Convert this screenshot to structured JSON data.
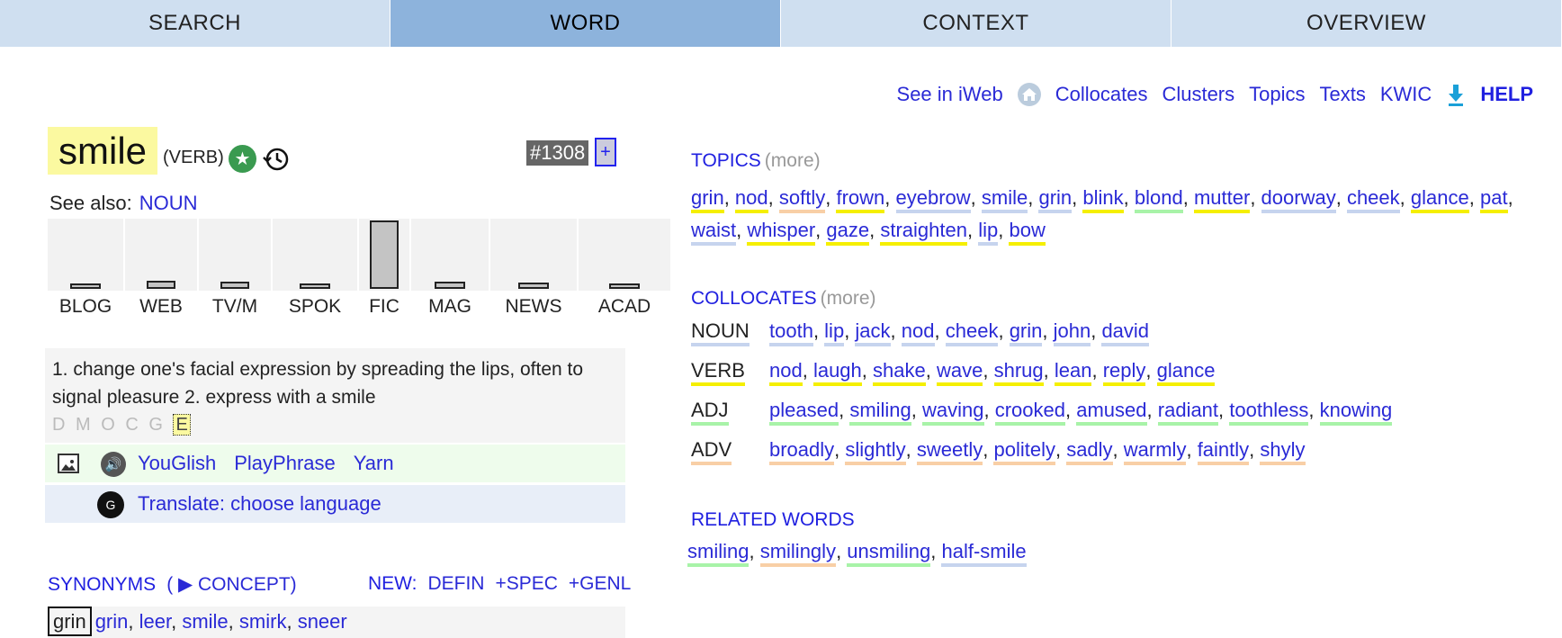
{
  "tabs": [
    "SEARCH",
    "WORD",
    "CONTEXT",
    "OVERVIEW"
  ],
  "toplinks": {
    "iweb": "See in iWeb",
    "collocates": "Collocates",
    "clusters": "Clusters",
    "topics": "Topics",
    "texts": "Texts",
    "kwic": "KWIC",
    "help": "HELP"
  },
  "word": {
    "headword": "smile",
    "pos": "(VERB)",
    "rank": "#1308",
    "plus": "+"
  },
  "see_also": {
    "label": "See also:",
    "link": "NOUN"
  },
  "genres": [
    {
      "label": "BLOG",
      "value": 0.08
    },
    {
      "label": "WEB",
      "value": 0.12
    },
    {
      "label": "TV/M",
      "value": 0.1
    },
    {
      "label": "SPOK",
      "value": 0.06
    },
    {
      "label": "FIC",
      "value": 1.0
    },
    {
      "label": "MAG",
      "value": 0.1
    },
    {
      "label": "NEWS",
      "value": 0.09
    },
    {
      "label": "ACAD",
      "value": 0.04
    }
  ],
  "definition": "1. change one's facial expression by spreading the lips, often to signal pleasure 2. express with a smile",
  "sources": {
    "inactive": "D M O C G",
    "active": "E"
  },
  "media": {
    "youglish": "YouGlish",
    "playphrase": "PlayPhrase",
    "yarn": "Yarn"
  },
  "translate": "Translate: choose language",
  "synonyms": {
    "title": "SYNONYMS",
    "concept": "( ▶ CONCEPT)",
    "new": "NEW:",
    "defin": "DEFIN",
    "spec": "+SPEC",
    "genl": "+GENL",
    "head": "grin",
    "list": [
      "grin",
      "leer",
      "smile",
      "smirk",
      "sneer"
    ]
  },
  "topics": {
    "title": "TOPICS",
    "more": "(more)",
    "words": [
      {
        "w": "grin",
        "c": "y"
      },
      {
        "w": "nod",
        "c": "y"
      },
      {
        "w": "softly",
        "c": "o"
      },
      {
        "w": "frown",
        "c": "y"
      },
      {
        "w": "eyebrow",
        "c": "b"
      },
      {
        "w": "smile",
        "c": "b"
      },
      {
        "w": "grin",
        "c": "b"
      },
      {
        "w": "blink",
        "c": "y"
      },
      {
        "w": "blond",
        "c": "g"
      },
      {
        "w": "mutter",
        "c": "y"
      },
      {
        "w": "doorway",
        "c": "b"
      },
      {
        "w": "cheek",
        "c": "b"
      },
      {
        "w": "glance",
        "c": "y"
      },
      {
        "w": "pat",
        "c": "y"
      },
      {
        "w": "waist",
        "c": "b"
      },
      {
        "w": "whisper",
        "c": "y"
      },
      {
        "w": "gaze",
        "c": "y"
      },
      {
        "w": "straighten",
        "c": "y"
      },
      {
        "w": "lip",
        "c": "b"
      },
      {
        "w": "bow",
        "c": "y"
      }
    ]
  },
  "collocates": {
    "title": "COLLOCATES",
    "more": "(more)",
    "rows": [
      {
        "label": "NOUN",
        "c": "b",
        "words": [
          "tooth",
          "lip",
          "jack",
          "nod",
          "cheek",
          "grin",
          "john",
          "david"
        ]
      },
      {
        "label": "VERB",
        "c": "y",
        "words": [
          "nod",
          "laugh",
          "shake",
          "wave",
          "shrug",
          "lean",
          "reply",
          "glance"
        ]
      },
      {
        "label": "ADJ",
        "c": "g",
        "words": [
          "pleased",
          "smiling",
          "waving",
          "crooked",
          "amused",
          "radiant",
          "toothless",
          "knowing"
        ]
      },
      {
        "label": "ADV",
        "c": "o",
        "words": [
          "broadly",
          "slightly",
          "sweetly",
          "politely",
          "sadly",
          "warmly",
          "faintly",
          "shyly"
        ]
      }
    ]
  },
  "related": {
    "title": "RELATED WORDS",
    "words": [
      {
        "w": "smiling",
        "c": "g"
      },
      {
        "w": "smilingly",
        "c": "o"
      },
      {
        "w": "unsmiling",
        "c": "g"
      },
      {
        "w": "half-smile",
        "c": "b"
      }
    ]
  }
}
